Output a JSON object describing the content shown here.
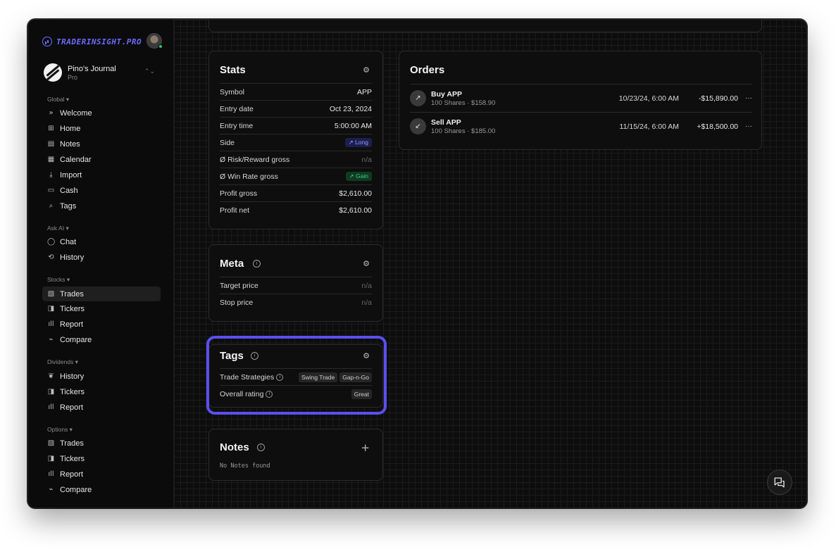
{
  "brand": {
    "name": "TRADERINSIGHT.PRO",
    "logo_icon": "signal-circle-icon",
    "accent": "#6d6cff"
  },
  "journal": {
    "title": "Pino's Journal",
    "plan": "Pro",
    "chevron": "⌃⌄"
  },
  "sidebar": {
    "sections": [
      {
        "label": "Global ▾",
        "items": [
          {
            "icon": "»",
            "label": "Welcome"
          },
          {
            "icon": "⊞",
            "label": "Home"
          },
          {
            "icon": "▤",
            "label": "Notes"
          },
          {
            "icon": "▦",
            "label": "Calendar"
          },
          {
            "icon": "⤓",
            "label": "Import"
          },
          {
            "icon": "▭",
            "label": "Cash"
          },
          {
            "icon": "⌕",
            "label": "Tags"
          }
        ]
      },
      {
        "label": "Ask AI ▾",
        "items": [
          {
            "icon": "◯",
            "label": "Chat"
          },
          {
            "icon": "⟲",
            "label": "History"
          }
        ]
      },
      {
        "label": "Stocks ▾",
        "items": [
          {
            "icon": "▧",
            "label": "Trades",
            "active": true
          },
          {
            "icon": "◨",
            "label": "Tickers"
          },
          {
            "icon": "ıll",
            "label": "Report"
          },
          {
            "icon": "⌁",
            "label": "Compare"
          }
        ]
      },
      {
        "label": "Dividends ▾",
        "items": [
          {
            "icon": "❦",
            "label": "History"
          },
          {
            "icon": "◨",
            "label": "Tickers"
          },
          {
            "icon": "ıll",
            "label": "Report"
          }
        ]
      },
      {
        "label": "Options ▾",
        "items": [
          {
            "icon": "▧",
            "label": "Trades"
          },
          {
            "icon": "◨",
            "label": "Tickers"
          },
          {
            "icon": "ıll",
            "label": "Report"
          },
          {
            "icon": "⌁",
            "label": "Compare"
          }
        ]
      }
    ]
  },
  "stats": {
    "title": "Stats",
    "settings_icon": "⚙",
    "rows": [
      {
        "label": "Symbol",
        "value": "APP"
      },
      {
        "label": "Entry date",
        "value": "Oct 23, 2024"
      },
      {
        "label": "Entry time",
        "value": "5:00:00 AM"
      },
      {
        "label": "Side",
        "badge": "↗ Long"
      },
      {
        "label": "Ø Risk/Reward gross",
        "value": "n/a",
        "muted": true
      },
      {
        "label": "Ø Win Rate gross",
        "badge": "↗ Gain"
      },
      {
        "label": "Profit gross",
        "value": "$2,610.00"
      },
      {
        "label": "Profit net",
        "value": "$2,610.00"
      }
    ]
  },
  "meta": {
    "title": "Meta",
    "rows": [
      {
        "label": "Target price",
        "value": "n/a"
      },
      {
        "label": "Stop price",
        "value": "n/a"
      }
    ]
  },
  "tags": {
    "title": "Tags",
    "strategies_label": "Trade Strategies",
    "strategies": [
      "Swing Trade",
      "Gap-n-Go"
    ],
    "rating_label": "Overall rating",
    "rating": "Great"
  },
  "notes": {
    "title": "Notes",
    "add": "+",
    "empty": "No Notes found"
  },
  "orders": {
    "title": "Orders",
    "items": [
      {
        "icon": "↗",
        "title": "Buy APP",
        "sub": "100 Shares · $158.90",
        "date": "10/23/24, 6:00 AM",
        "amount": "-$15,890.00",
        "more": "···"
      },
      {
        "icon": "↙",
        "title": "Sell APP",
        "sub": "100 Shares · $185.00",
        "date": "11/15/24, 6:00 AM",
        "amount": "+$18,500.00",
        "more": "···"
      }
    ]
  },
  "highlight_color": "#5b4ff0"
}
